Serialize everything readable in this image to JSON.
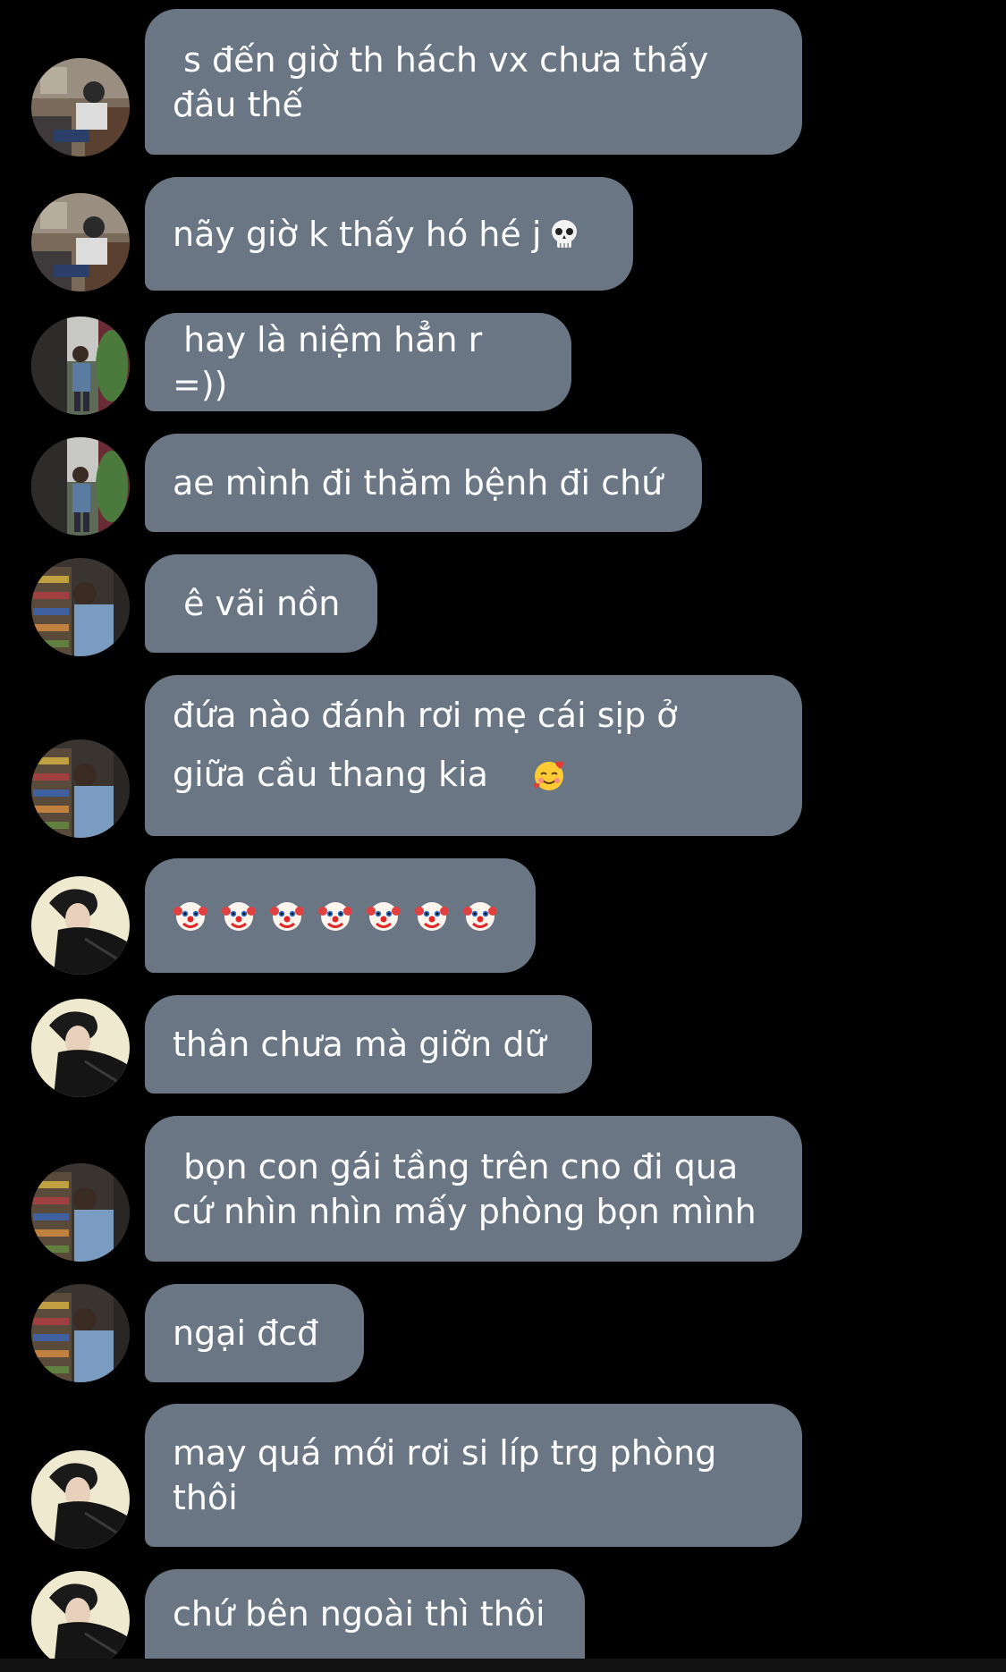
{
  "messages": [
    {
      "avatar": "couch",
      "text": " s đến giờ th hách vx chưa thấy\nđâu thế"
    },
    {
      "avatar": "couch",
      "text": "nãy giờ k thấy hó hé j",
      "emoji": "skull-icon"
    },
    {
      "avatar": "street",
      "text": " hay là niệm hẳn r =))"
    },
    {
      "avatar": "street",
      "text": "ae mình đi thăm bệnh đi chứ"
    },
    {
      "avatar": "store",
      "text": " ê vãi nồn"
    },
    {
      "avatar": "store",
      "text": "đứa nào đánh rơi mẹ cái sịp ở\ngiữa cầu thang kia",
      "emoji": "smiling-face-with-hearts-icon"
    },
    {
      "avatar": "portrait",
      "text": "",
      "clown_count": 7
    },
    {
      "avatar": "portrait",
      "text": "thân chưa mà giỡn dữ"
    },
    {
      "avatar": "store",
      "text": " bọn con gái tầng trên cno đi qua\ncứ nhìn nhìn mấy phòng bọn mình"
    },
    {
      "avatar": "store",
      "text": "ngại đcđ"
    },
    {
      "avatar": "portrait",
      "text": "may quá mới rơi si líp trg phòng\nthôi"
    },
    {
      "avatar": "portrait",
      "text": "chứ bên ngoài thì thôi"
    }
  ],
  "colors": {
    "background": "#000000",
    "bubble": "#6a7684",
    "text": "#ffffff"
  }
}
